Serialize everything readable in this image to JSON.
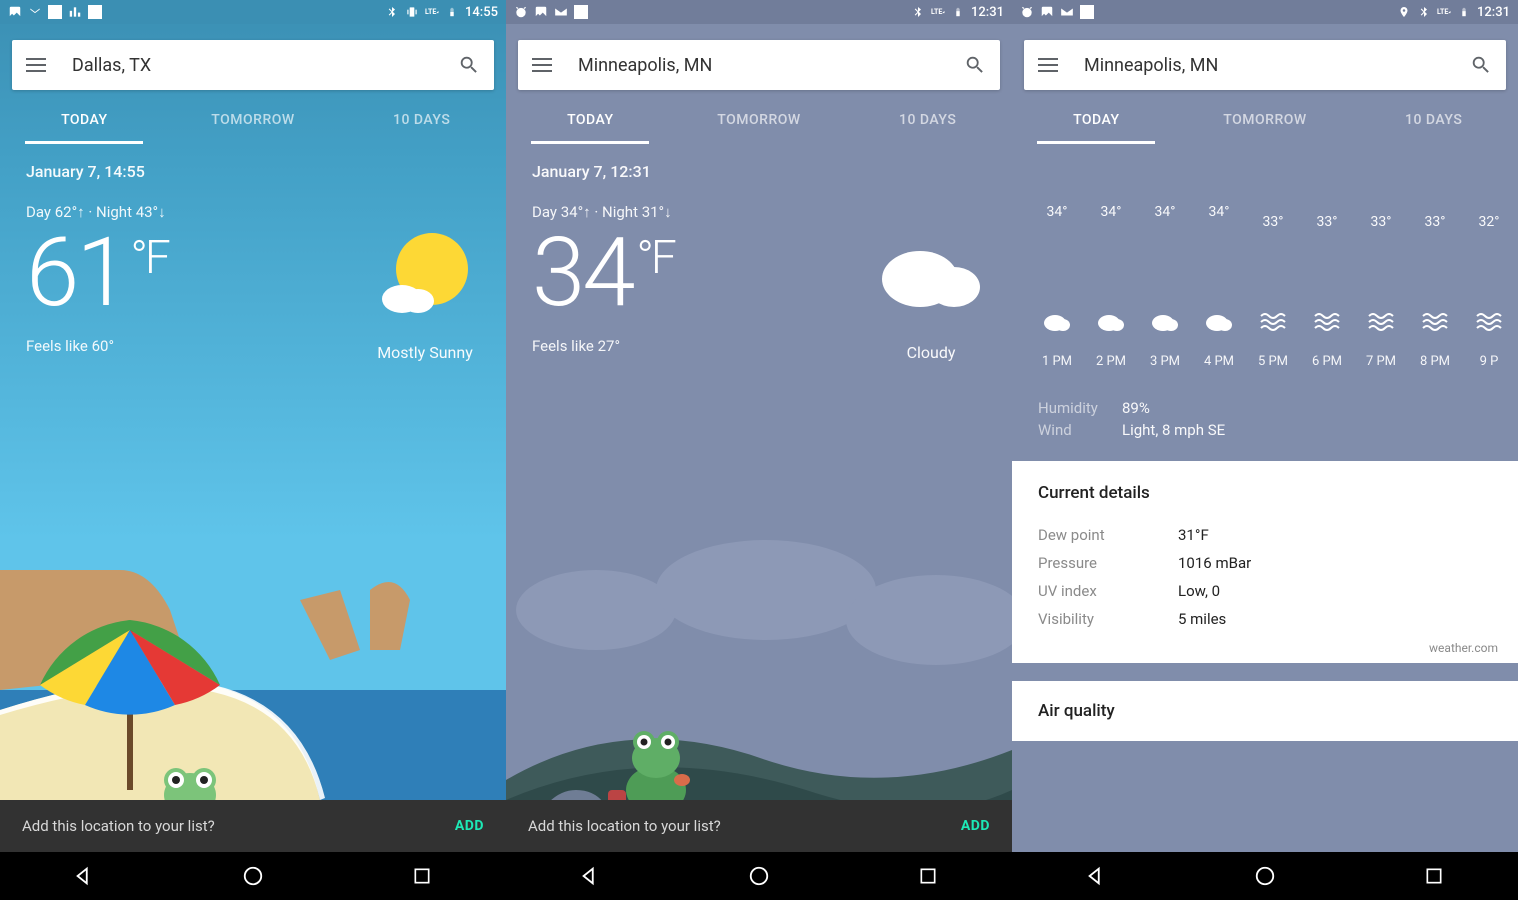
{
  "panel1": {
    "status_time": "14:55",
    "location": "Dallas, TX",
    "tabs": {
      "today": "TODAY",
      "tomorrow": "TOMORROW",
      "tendays": "10 DAYS"
    },
    "date": "January 7, 14:55",
    "daynight": "Day 62°↑ · Night 43°↓",
    "temp": "61",
    "unit": "°F",
    "feels": "Feels like 60°",
    "condition": "Mostly Sunny",
    "addq": "Add this location to your list?",
    "add": "ADD"
  },
  "panel2": {
    "status_time": "12:31",
    "location": "Minneapolis, MN",
    "tabs": {
      "today": "TODAY",
      "tomorrow": "TOMORROW",
      "tendays": "10 DAYS"
    },
    "date": "January 7, 12:31",
    "daynight": "Day 34°↑ · Night 31°↓",
    "temp": "34",
    "unit": "°F",
    "feels": "Feels like 27°",
    "condition": "Cloudy",
    "addq": "Add this location to your list?",
    "add": "ADD"
  },
  "panel3": {
    "status_time": "12:31",
    "location": "Minneapolis, MN",
    "tabs": {
      "today": "TODAY",
      "tomorrow": "TOMORROW",
      "tendays": "10 DAYS"
    },
    "hourly": [
      {
        "temp": "34°",
        "time": "1 PM",
        "icon": "cloud"
      },
      {
        "temp": "34°",
        "time": "2 PM",
        "icon": "cloud"
      },
      {
        "temp": "34°",
        "time": "3 PM",
        "icon": "cloud"
      },
      {
        "temp": "34°",
        "time": "4 PM",
        "icon": "cloud"
      },
      {
        "temp": "33°",
        "time": "5 PM",
        "icon": "fog"
      },
      {
        "temp": "33°",
        "time": "6 PM",
        "icon": "fog"
      },
      {
        "temp": "33°",
        "time": "7 PM",
        "icon": "fog"
      },
      {
        "temp": "33°",
        "time": "8 PM",
        "icon": "fog"
      },
      {
        "temp": "32°",
        "time": "9 P",
        "icon": "fog"
      }
    ],
    "humidity_k": "Humidity",
    "humidity_v": "89%",
    "wind_k": "Wind",
    "wind_v": "Light, 8 mph SE",
    "details_title": "Current details",
    "details": {
      "dew_k": "Dew point",
      "dew_v": "31°F",
      "press_k": "Pressure",
      "press_v": "1016 mBar",
      "uv_k": "UV index",
      "uv_v": "Low, 0",
      "vis_k": "Visibility",
      "vis_v": "5 miles"
    },
    "attrib": "weather.com",
    "aq_title": "Air quality"
  }
}
